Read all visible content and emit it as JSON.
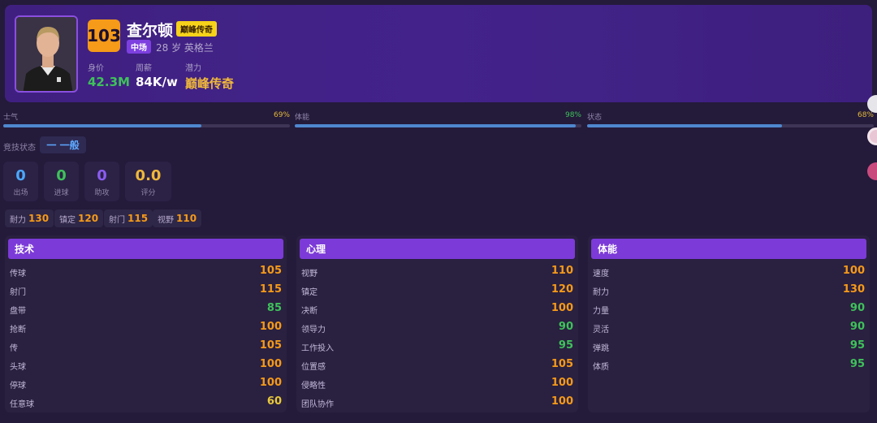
{
  "player": {
    "rating": "103",
    "name": "查尔顿",
    "tier_badge": "巅峰传奇",
    "position": "中场",
    "age_nation": "28 岁  英格兰"
  },
  "info": {
    "value_label": "身价",
    "value": "42.3M",
    "wage_label": "周薪",
    "wage": "84K/w",
    "potential_label": "潜力",
    "potential": "巅峰传奇"
  },
  "bars": [
    {
      "label": "士气",
      "pct_text": "69%",
      "pct": 0.69,
      "pct_color": "#e0b73a"
    },
    {
      "label": "体能",
      "pct_text": "98%",
      "pct": 0.98,
      "pct_color": "#3ec25a"
    },
    {
      "label": "状态",
      "pct_text": "68%",
      "pct": 0.68,
      "pct_color": "#e0b73a"
    }
  ],
  "competition": {
    "label": "竞技状态",
    "value": "一 一般"
  },
  "stats": [
    {
      "value": "0",
      "label": "出场",
      "color": "#4aa8ff"
    },
    {
      "value": "0",
      "label": "进球",
      "color": "#3ec25a"
    },
    {
      "value": "0",
      "label": "助攻",
      "color": "#8a5cf0"
    },
    {
      "value": "0.0",
      "label": "评分",
      "color": "#f0b83a"
    }
  ],
  "chips": [
    {
      "label": "耐力",
      "value": "130"
    },
    {
      "label": "镇定",
      "value": "120"
    },
    {
      "label": "射门",
      "value": "115"
    },
    {
      "label": "视野",
      "value": "110"
    }
  ],
  "panels": [
    {
      "title": "技术",
      "rows": [
        {
          "k": "传球",
          "v": "105",
          "c": "#f59a19"
        },
        {
          "k": "射门",
          "v": "115",
          "c": "#f59a19"
        },
        {
          "k": "盘带",
          "v": "85",
          "c": "#3ec25a"
        },
        {
          "k": "抢断",
          "v": "100",
          "c": "#f59a19"
        },
        {
          "k": "传",
          "v": "105",
          "c": "#f59a19"
        },
        {
          "k": "头球",
          "v": "100",
          "c": "#f59a19"
        },
        {
          "k": "停球",
          "v": "100",
          "c": "#f59a19"
        },
        {
          "k": "任意球",
          "v": "60",
          "c": "#e8c93a"
        }
      ]
    },
    {
      "title": "心理",
      "rows": [
        {
          "k": "视野",
          "v": "110",
          "c": "#f59a19"
        },
        {
          "k": "镇定",
          "v": "120",
          "c": "#f59a19"
        },
        {
          "k": "决断",
          "v": "100",
          "c": "#f59a19"
        },
        {
          "k": "领导力",
          "v": "90",
          "c": "#3ec25a"
        },
        {
          "k": "工作投入",
          "v": "95",
          "c": "#3ec25a"
        },
        {
          "k": "位置感",
          "v": "105",
          "c": "#f59a19"
        },
        {
          "k": "侵略性",
          "v": "100",
          "c": "#f59a19"
        },
        {
          "k": "团队协作",
          "v": "100",
          "c": "#f59a19"
        }
      ]
    },
    {
      "title": "体能",
      "rows": [
        {
          "k": "速度",
          "v": "100",
          "c": "#f59a19"
        },
        {
          "k": "耐力",
          "v": "130",
          "c": "#f59a19"
        },
        {
          "k": "力量",
          "v": "90",
          "c": "#3ec25a"
        },
        {
          "k": "灵活",
          "v": "90",
          "c": "#3ec25a"
        },
        {
          "k": "弹跳",
          "v": "95",
          "c": "#3ec25a"
        },
        {
          "k": "体质",
          "v": "95",
          "c": "#3ec25a"
        }
      ]
    }
  ],
  "colors": {
    "value_green": "#3ec25a",
    "potential_gold": "#f0b83a"
  }
}
